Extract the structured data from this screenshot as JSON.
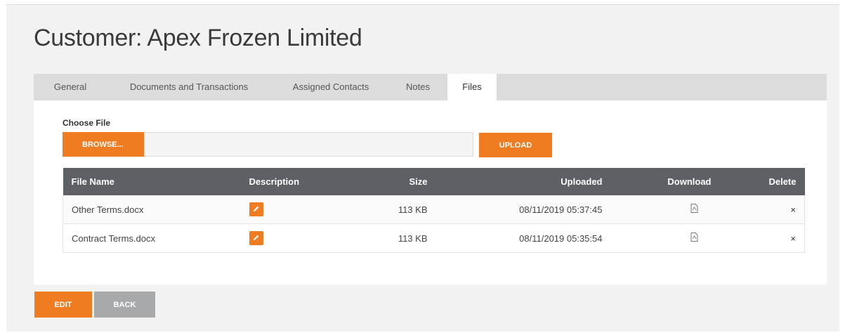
{
  "header": {
    "title": "Customer: Apex Frozen Limited"
  },
  "tabs": [
    {
      "label": "General"
    },
    {
      "label": "Documents and Transactions"
    },
    {
      "label": "Assigned Contacts"
    },
    {
      "label": "Notes"
    },
    {
      "label": "Files",
      "active": true
    }
  ],
  "upload": {
    "choose_label": "Choose File",
    "browse_label": "BROWSE...",
    "file_path_value": "",
    "upload_label": "UPLOAD"
  },
  "table": {
    "columns": [
      "File Name",
      "Description",
      "Size",
      "Uploaded",
      "Download",
      "Delete"
    ],
    "rows": [
      {
        "file_name": "Other Terms.docx",
        "size": "113 KB",
        "uploaded": "08/11/2019 05:37:45",
        "delete": "×"
      },
      {
        "file_name": "Contract Terms.docx",
        "size": "113 KB",
        "uploaded": "08/11/2019 05:35:54",
        "delete": "×"
      }
    ]
  },
  "footer": {
    "edit_label": "EDIT",
    "back_label": "BACK"
  },
  "colors": {
    "accent": "#f07c22",
    "header_bg": "#5d6065",
    "secondary_button": "#a7a9ab"
  }
}
